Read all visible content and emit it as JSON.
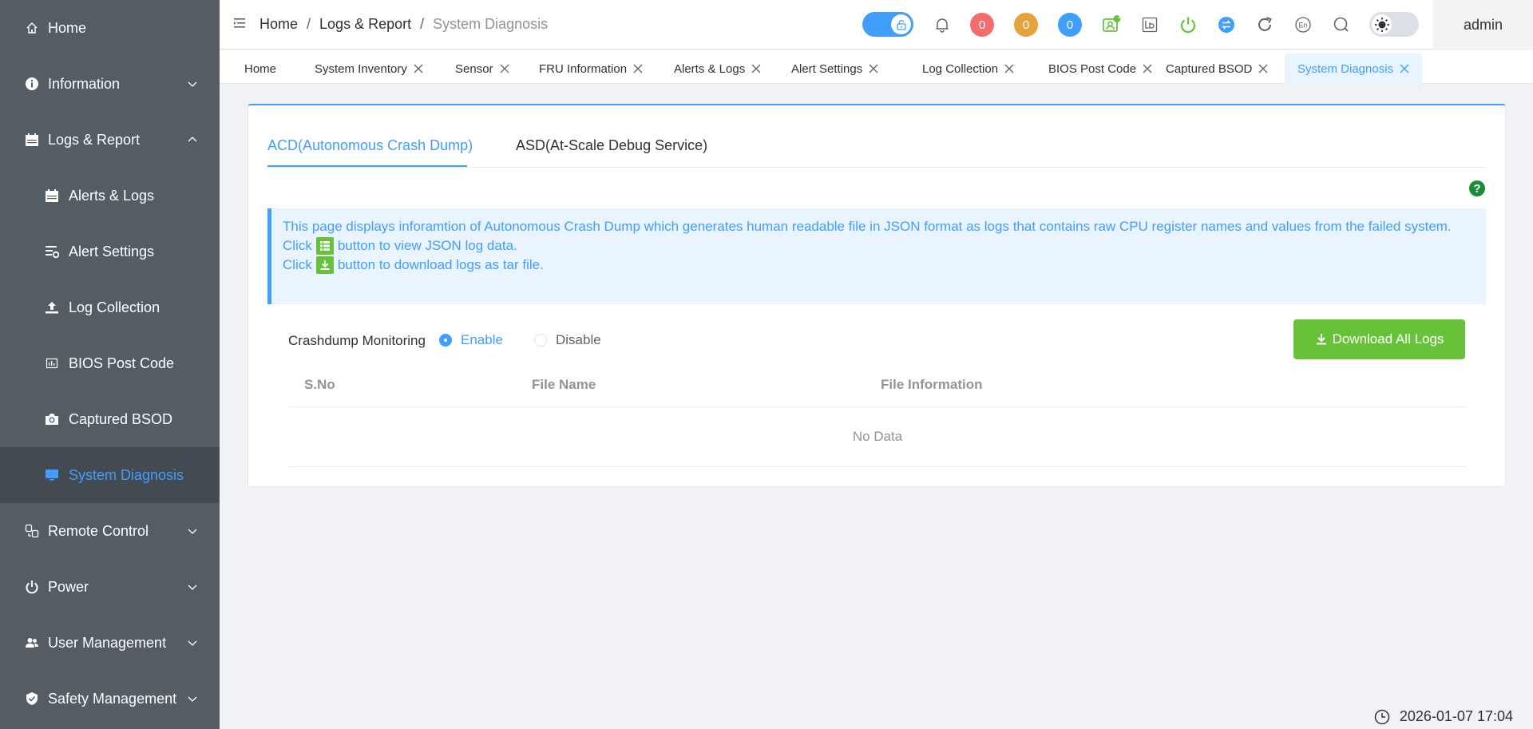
{
  "sidebar": {
    "items": [
      {
        "label": "Home"
      },
      {
        "label": "Information"
      },
      {
        "label": "Logs & Report"
      },
      {
        "label": "Alerts & Logs"
      },
      {
        "label": "Alert Settings"
      },
      {
        "label": "Log Collection"
      },
      {
        "label": "BIOS Post Code"
      },
      {
        "label": "Captured BSOD"
      },
      {
        "label": "System Diagnosis"
      },
      {
        "label": "Remote Control"
      },
      {
        "label": "Power"
      },
      {
        "label": "User Management"
      },
      {
        "label": "Safety Management"
      }
    ]
  },
  "header": {
    "breadcrumb": [
      "Home",
      "Logs & Report",
      "System Diagnosis"
    ],
    "separator": "/",
    "badges": {
      "red": "0",
      "orange": "0",
      "blue": "0",
      "notify": "1"
    },
    "lang": "En",
    "user": "admin"
  },
  "tabs": [
    "Home",
    "System Inventory",
    "Sensor",
    "FRU Information",
    "Alerts & Logs",
    "Alert Settings",
    "Log Collection",
    "BIOS Post Code",
    "Captured BSOD",
    "System Diagnosis"
  ],
  "page": {
    "subtabs": [
      "ACD(Autonomous Crash Dump)",
      "ASD(At-Scale Debug Service)"
    ],
    "help": "?",
    "info": {
      "line1": "This page displays inforamtion of Autonomous Crash Dump which generates human readable file in JSON format as logs that contains raw CPU register names and values from the failed system.",
      "click": "Click",
      "line2_rest": "button to view JSON log data.",
      "line3_rest": "button to download logs as tar file."
    },
    "monitoring_label": "Crashdump Monitoring",
    "enable_label": "Enable",
    "disable_label": "Disable",
    "monitoring_value": "Enable",
    "download_all_label": "Download All Logs",
    "table": {
      "columns": [
        "S.No",
        "File Name",
        "File Information"
      ],
      "empty_text": "No Data"
    }
  },
  "datetime": "2026-01-07 17:04",
  "colors": {
    "sidebar_bg": "#545c64",
    "accent": "#409eff",
    "success": "#67c23a",
    "danger": "#f56c6c",
    "warning": "#e6a23c"
  }
}
